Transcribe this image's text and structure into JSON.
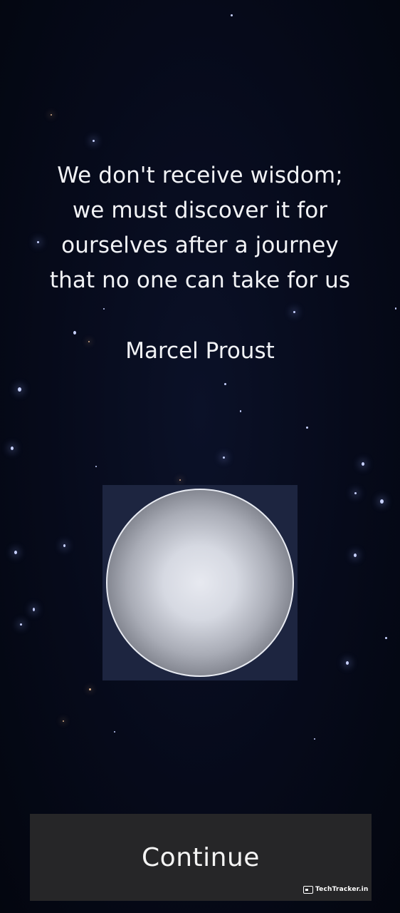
{
  "quote": {
    "lines": [
      "We don't receive wisdom;",
      "we must discover it for",
      "ourselves after a journey",
      "that no one can take for us"
    ],
    "author": "Marcel Proust"
  },
  "continue_button": {
    "label": "Continue"
  },
  "watermark": {
    "text": "TechTracker.in"
  },
  "colors": {
    "background": "#060a1a",
    "text": "#f2f3f6",
    "orb_frame": "#1d2540",
    "button": "#262628"
  }
}
